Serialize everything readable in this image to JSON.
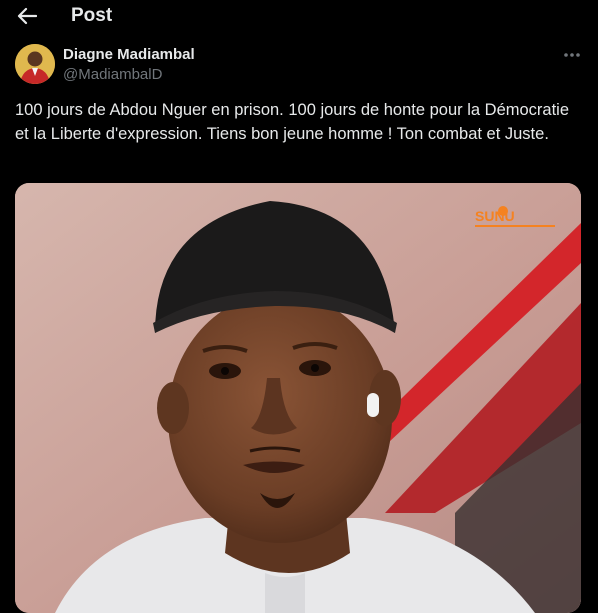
{
  "header": {
    "title": "Post",
    "back_icon": "arrow-left-icon"
  },
  "author": {
    "name": "Diagne Madiambal",
    "handle": "@MadiambalD",
    "avatar_icon": "avatar"
  },
  "post": {
    "text": "100 jours de Abdou Nguer en prison. 100 jours de honte pour la Démocratie et la Liberte d'expression. Tiens bon jeune homme ! Ton combat et Juste.",
    "more_icon": "more-horizontal-icon"
  },
  "media": {
    "watermark": "SUNU",
    "description_icon": "photo"
  },
  "colors": {
    "background": "#000000",
    "text": "#e7e9ea",
    "secondary_text": "#71767b"
  }
}
